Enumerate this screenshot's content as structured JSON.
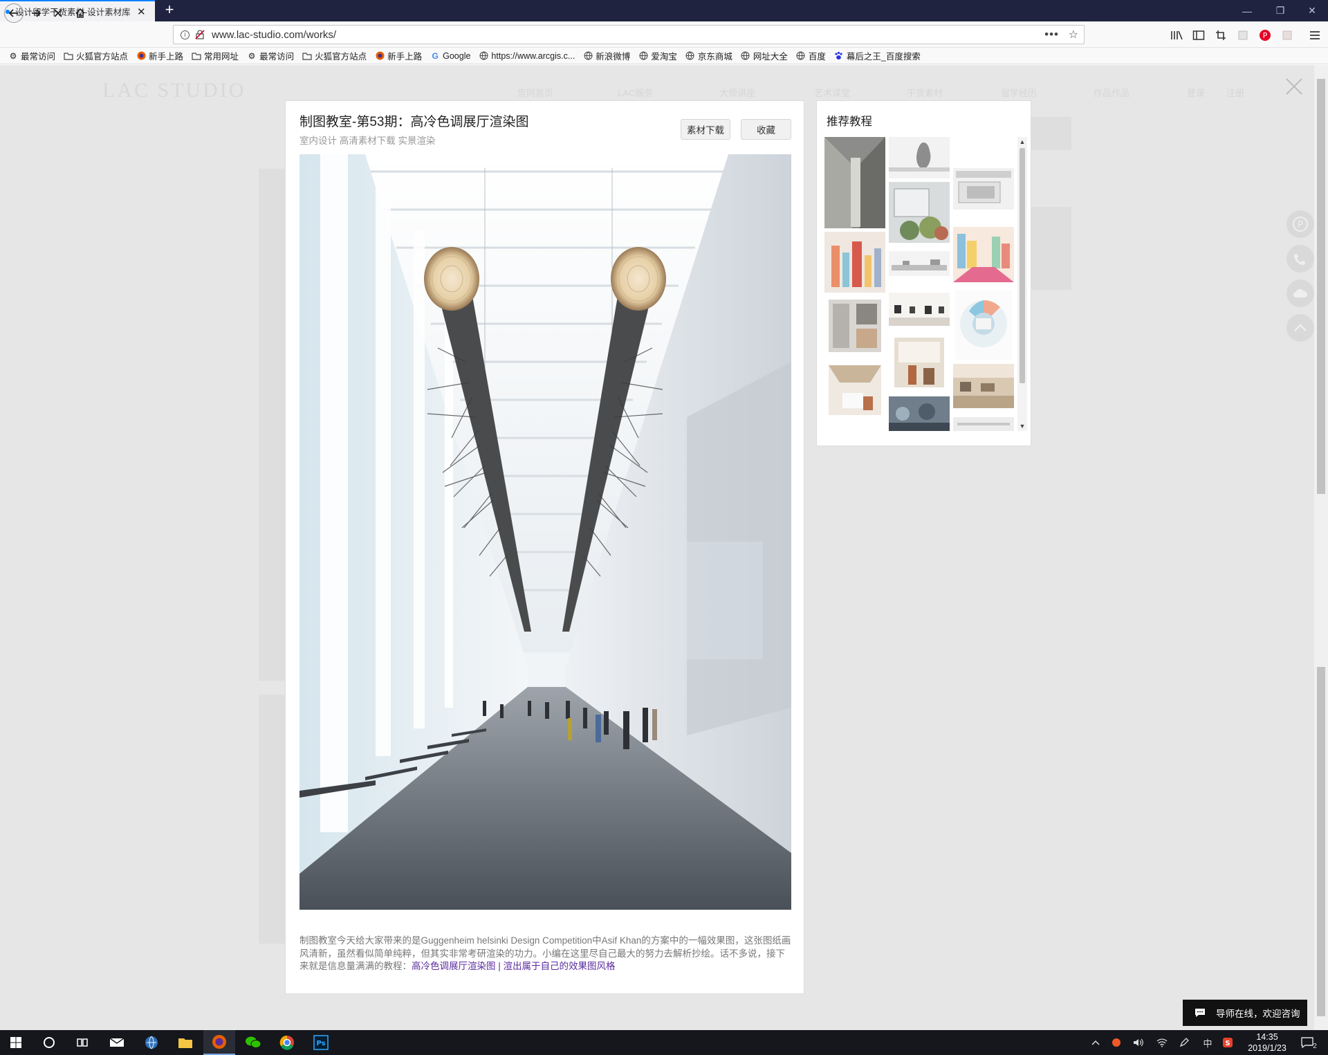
{
  "browser": {
    "tab_title": "设计留学干货素材-设计素材库",
    "tab_close": "✕",
    "new_tab": "+",
    "url": "www.lac-studio.com/works/",
    "url_menu": "•••",
    "bookmark_star": "☆",
    "window_controls": {
      "minimize": "—",
      "restore": "❐",
      "close": "✕"
    }
  },
  "bookmarks": [
    {
      "label": "最常访问",
      "icon": "gear-icon"
    },
    {
      "label": "火狐官方站点",
      "icon": "folder-icon"
    },
    {
      "label": "新手上路",
      "icon": "firefox-icon"
    },
    {
      "label": "常用网址",
      "icon": "folder-icon"
    },
    {
      "label": "最常访问",
      "icon": "gear-icon"
    },
    {
      "label": "火狐官方站点",
      "icon": "folder-icon"
    },
    {
      "label": "新手上路",
      "icon": "firefox-icon"
    },
    {
      "label": "Google",
      "icon": "google-icon"
    },
    {
      "label": "https://www.arcgis.c...",
      "icon": "globe-icon"
    },
    {
      "label": "新浪微博",
      "icon": "globe-icon"
    },
    {
      "label": "爱淘宝",
      "icon": "globe-icon"
    },
    {
      "label": "京东商城",
      "icon": "globe-icon"
    },
    {
      "label": "网址大全",
      "icon": "globe-icon"
    },
    {
      "label": "百度",
      "icon": "globe-icon"
    },
    {
      "label": "幕后之王_百度搜索",
      "icon": "baidu-paw-icon"
    }
  ],
  "site": {
    "logo": "LAC STUDIO",
    "nav": [
      "官网首页",
      "LAC服务",
      "大师讲座",
      "艺术课堂",
      "干货素材",
      "留学经历",
      "作品作品",
      "登录",
      "注册"
    ]
  },
  "modal": {
    "title": "制图教室-第53期：高冷色调展厅渲染图",
    "tags": "室内设计 高清素材下载 实景渲染",
    "download_label": "素材下载",
    "collect_label": "收藏",
    "description": "制图教室今天给大家带来的是Guggenheim helsinki Design Competition中Asif Khan的方案中的一幅效果图，这张图纸画风清新，虽然看似简单纯粹，但其实非常考研渲染的功力。小编在这里尽自己最大的努力去解析抄绘。话不多说，接下来就是信息量满满的教程：",
    "link_label": "高冷色调展厅渲染图 | 渲出属于自己的效果图风格"
  },
  "recommend": {
    "title": "推荐教程"
  },
  "chat": {
    "label": "导师在线，欢迎咨询"
  },
  "taskbar": {
    "time": "14:35",
    "date": "2019/1/23",
    "ime": "中",
    "notification_count": "2"
  },
  "colors": {
    "titlebar": "#202340",
    "accent": "#0a84ff",
    "link": "#5a2c9e",
    "overlay_bg": "#e6e6e6"
  }
}
